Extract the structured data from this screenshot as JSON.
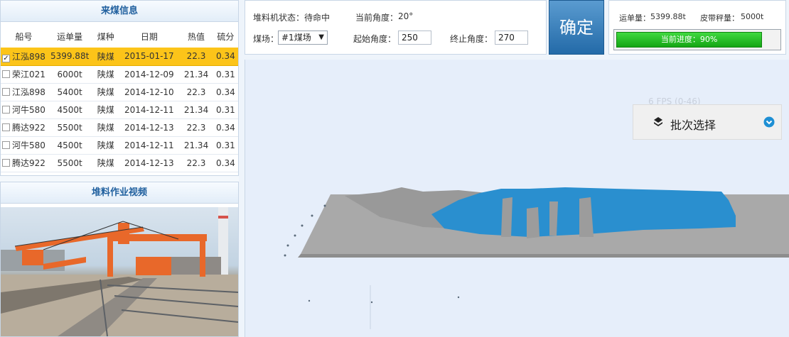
{
  "coal_panel": {
    "title": "来煤信息",
    "columns": [
      "船号",
      "运单量",
      "煤种",
      "日期",
      "热值",
      "硫分"
    ],
    "rows": [
      {
        "ship": "江泓898",
        "amount": "5399.88t",
        "type": "陕煤",
        "date": "2015-01-17",
        "heat": "22.3",
        "sulfur": "0.34",
        "checked": true
      },
      {
        "ship": "荣江021",
        "amount": "6000t",
        "type": "陕煤",
        "date": "2014-12-09",
        "heat": "21.34",
        "sulfur": "0.31",
        "checked": false
      },
      {
        "ship": "江泓898",
        "amount": "5400t",
        "type": "陕煤",
        "date": "2014-12-10",
        "heat": "22.3",
        "sulfur": "0.34",
        "checked": false
      },
      {
        "ship": "河牛580",
        "amount": "4500t",
        "type": "陕煤",
        "date": "2014-12-11",
        "heat": "21.34",
        "sulfur": "0.31",
        "checked": false
      },
      {
        "ship": "腾达922",
        "amount": "5500t",
        "type": "陕煤",
        "date": "2014-12-13",
        "heat": "22.3",
        "sulfur": "0.34",
        "checked": false
      },
      {
        "ship": "河牛580",
        "amount": "4500t",
        "type": "陕煤",
        "date": "2014-12-11",
        "heat": "21.34",
        "sulfur": "0.31",
        "checked": false
      },
      {
        "ship": "腾达922",
        "amount": "5500t",
        "type": "陕煤",
        "date": "2014-12-13",
        "heat": "22.3",
        "sulfur": "0.34",
        "checked": false
      }
    ]
  },
  "video_panel": {
    "title": "堆料作业视频"
  },
  "status": {
    "stacker_state_label": "堆料机状态：",
    "stacker_state_value": "待命中",
    "current_angle_label": "当前角度：",
    "current_angle_value": "20°",
    "yard_label": "煤场：",
    "yard_value": "#1煤场",
    "start_angle_label": "起始角度：",
    "start_angle_value": "250",
    "end_angle_label": "终止角度：",
    "end_angle_value": "270"
  },
  "confirm_label": "确定",
  "stats": {
    "waybill_label": "运单量：",
    "waybill_value": "5399.88t",
    "belt_label": "皮带秤量：",
    "belt_value": "5000t",
    "progress_text": "当前进度：90%",
    "progress_value": 0.9
  },
  "view": {
    "fps_text": "6 FPS (0-46)",
    "batch_label": "批次选择",
    "pile_color": "#2a8fcf",
    "ground_color": "#a9a9a9"
  }
}
